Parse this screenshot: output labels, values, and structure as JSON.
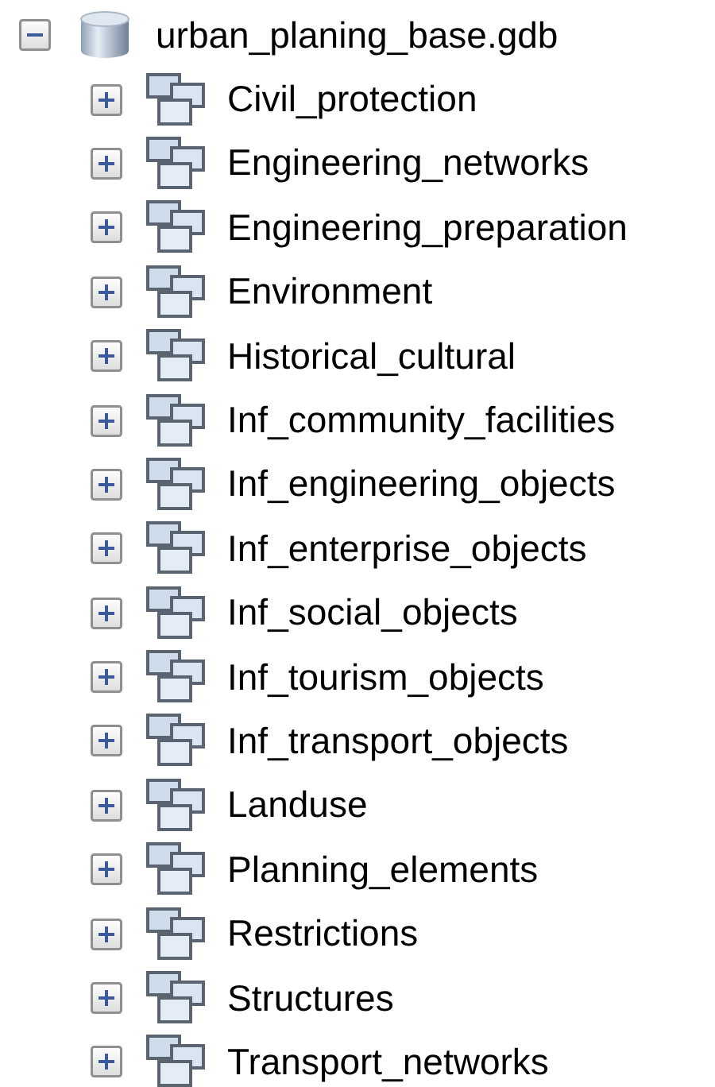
{
  "tree": {
    "label": "urban_planing_base.gdb",
    "expanded": true,
    "children": [
      {
        "label": "Civil_protection",
        "expanded": false
      },
      {
        "label": "Engineering_networks",
        "expanded": false
      },
      {
        "label": "Engineering_preparation",
        "expanded": false
      },
      {
        "label": "Environment",
        "expanded": false
      },
      {
        "label": "Historical_cultural",
        "expanded": false
      },
      {
        "label": "Inf_community_facilities",
        "expanded": false
      },
      {
        "label": "Inf_engineering_objects",
        "expanded": false
      },
      {
        "label": "Inf_enterprise_objects",
        "expanded": false
      },
      {
        "label": "Inf_social_objects",
        "expanded": false
      },
      {
        "label": "Inf_tourism_objects",
        "expanded": false
      },
      {
        "label": "Inf_transport_objects",
        "expanded": false
      },
      {
        "label": "Landuse",
        "expanded": false
      },
      {
        "label": "Planning_elements",
        "expanded": false
      },
      {
        "label": "Restrictions",
        "expanded": false
      },
      {
        "label": "Structures",
        "expanded": false
      },
      {
        "label": "Transport_networks",
        "expanded": false
      }
    ]
  }
}
